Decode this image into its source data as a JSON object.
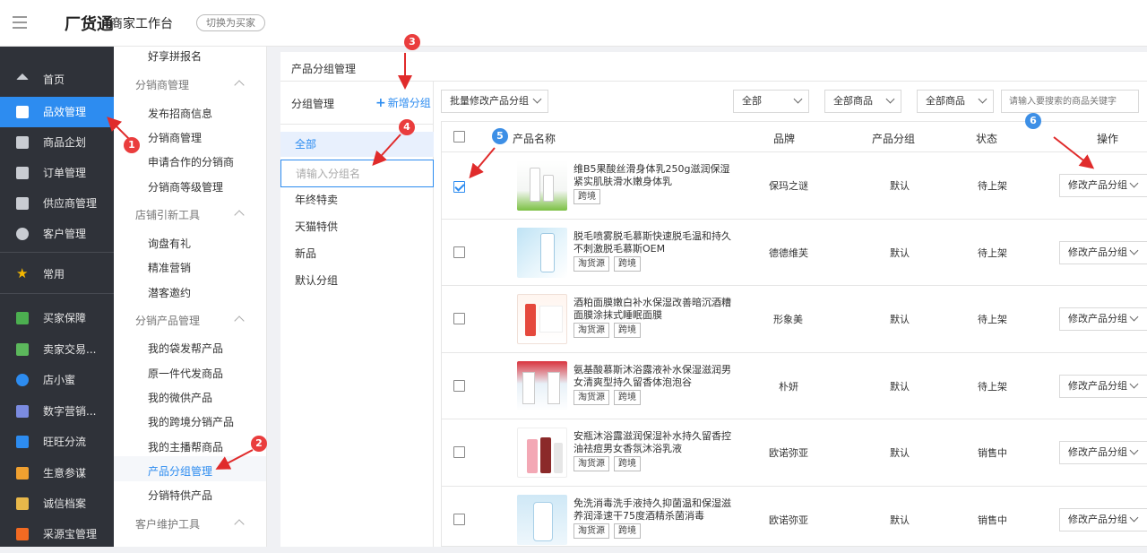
{
  "topbar": {
    "logo": "厂货通",
    "title": "商家工作台",
    "switch_label": "切换为买家"
  },
  "left_nav": [
    {
      "label": "首页",
      "icon": "home-icon"
    },
    {
      "label": "品效管理",
      "icon": "chart-icon",
      "active": true
    },
    {
      "label": "商品企划",
      "icon": "calendar-icon"
    },
    {
      "label": "订单管理",
      "icon": "order-icon"
    },
    {
      "label": "供应商管理",
      "icon": "supplier-icon"
    },
    {
      "label": "客户管理",
      "icon": "user-icon"
    },
    {
      "label": "常用",
      "icon": "star-icon"
    },
    {
      "label": "买家保障",
      "icon": "shield-icon"
    },
    {
      "label": "卖家交易...",
      "icon": "trade-icon"
    },
    {
      "label": "店小蜜",
      "icon": "bot-icon"
    },
    {
      "label": "数字营销...",
      "icon": "mail-icon"
    },
    {
      "label": "旺旺分流",
      "icon": "wangwang-icon"
    },
    {
      "label": "生意参谋",
      "icon": "advisor-icon"
    },
    {
      "label": "诚信档案",
      "icon": "credit-icon"
    },
    {
      "label": "采源宝管理",
      "icon": "source-icon"
    }
  ],
  "sub_nav": {
    "top_item": "好享拼报名",
    "groups": [
      {
        "title": "分销商管理",
        "items": [
          "发布招商信息",
          "分销商管理",
          "申请合作的分销商",
          "分销商等级管理"
        ]
      },
      {
        "title": "店铺引新工具",
        "items": [
          "询盘有礼",
          "精准营销",
          "潜客邀约"
        ]
      },
      {
        "title": "分销产品管理",
        "items": [
          "我的袋发帮产品",
          "原一件代发商品",
          "我的微供产品",
          "我的跨境分销产品",
          "我的主播帮商品",
          "产品分组管理",
          "分销特供产品"
        ]
      },
      {
        "title": "客户维护工具",
        "items": []
      }
    ],
    "active_item": "产品分组管理"
  },
  "main": {
    "title": "产品分组管理",
    "group_panel": {
      "title": "分组管理",
      "add_label": "新增分组",
      "input_placeholder": "请输入分组名",
      "groups": [
        "全部",
        "年终特卖",
        "天猫特供",
        "新品",
        "默认分组"
      ]
    },
    "toolbar": {
      "batch_label": "批量修改产品分组",
      "filter1": "全部",
      "filter2": "全部商品",
      "filter3": "全部商品",
      "search_placeholder": "请输入要搜索的商品关键字"
    },
    "table": {
      "headers": {
        "name": "产品名称",
        "brand": "品牌",
        "group": "产品分组",
        "status": "状态",
        "ops": "操作"
      },
      "op_label": "修改产品分组",
      "rows": [
        {
          "name": "维B5果酸丝滑身体乳250g滋润保湿紧实肌肤滑水嫩身体乳",
          "tags": [
            "跨境"
          ],
          "brand": "保玛之谜",
          "group": "默认",
          "status": "待上架",
          "checked": true
        },
        {
          "name": "脱毛喷雾脱毛慕斯快速脱毛温和持久不刺激脱毛慕斯OEM",
          "tags": [
            "淘货源",
            "跨境"
          ],
          "brand": "德德维芙",
          "group": "默认",
          "status": "待上架",
          "checked": false
        },
        {
          "name": "酒粕面膜嫩白补水保湿改善暗沉酒糟面膜涂抹式睡眠面膜",
          "tags": [
            "淘货源",
            "跨境"
          ],
          "brand": "形象美",
          "group": "默认",
          "status": "待上架",
          "checked": false
        },
        {
          "name": "氨基酸慕斯沐浴露液补水保湿滋润男女清爽型持久留香体泡泡谷",
          "tags": [
            "淘货源",
            "跨境"
          ],
          "brand": "朴妍",
          "group": "默认",
          "status": "待上架",
          "checked": false
        },
        {
          "name": "安瓶沐浴露滋润保湿补水持久留香控油祛痘男女香氛沐浴乳液",
          "tags": [
            "淘货源",
            "跨境"
          ],
          "brand": "欧诺弥亚",
          "group": "默认",
          "status": "销售中",
          "checked": false
        },
        {
          "name": "免洗消毒洗手液持久抑菌温和保湿滋养润泽速干75度酒精杀菌消毒",
          "tags": [
            "淘货源",
            "跨境"
          ],
          "brand": "欧诺弥亚",
          "group": "默认",
          "status": "销售中",
          "checked": false
        }
      ]
    }
  },
  "annotations": [
    "1",
    "2",
    "3",
    "4",
    "5",
    "6"
  ],
  "colors": {
    "accent": "#2d8cf0",
    "nav_bg": "#2f3239",
    "badge_red": "#ea3d3d",
    "badge_blue": "#3d8fe6"
  }
}
